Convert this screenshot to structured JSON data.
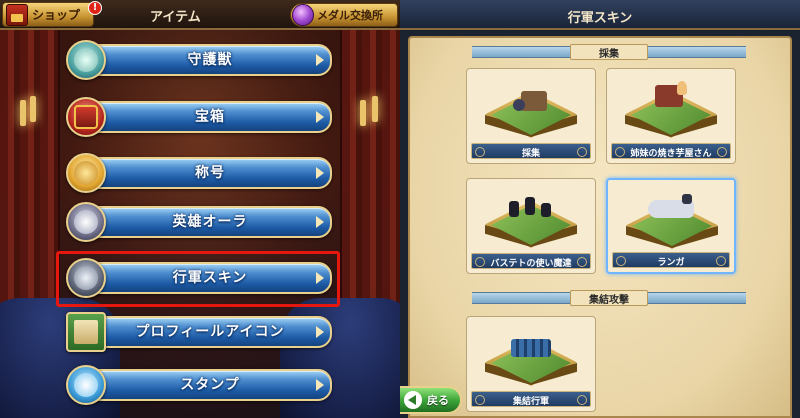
{
  "left_panel": {
    "shop_label": "ショップ",
    "shop_badge": "!",
    "tab_title": "アイテム",
    "medal_exchange_label": "メダル交換所",
    "menu": [
      {
        "label": "守護獣",
        "icon": "dragon-icon",
        "selected": false
      },
      {
        "label": "宝箱",
        "icon": "treasure-chest-icon",
        "selected": false
      },
      {
        "label": "称号",
        "icon": "emblem-icon",
        "selected": false
      },
      {
        "label": "英雄オーラ",
        "icon": "hero-aura-icon",
        "selected": false
      },
      {
        "label": "行軍スキン",
        "icon": "armored-knight-icon",
        "selected": true
      },
      {
        "label": "プロフィールアイコン",
        "icon": "profile-book-icon",
        "selected": false
      },
      {
        "label": "スタンプ",
        "icon": "stamp-character-icon",
        "selected": false
      }
    ]
  },
  "right_panel": {
    "title": "行軍スキン",
    "sections": [
      {
        "header": "採集",
        "cards": [
          {
            "name": "採集",
            "selected": false
          },
          {
            "name": "姉妹の焼き芋屋さん",
            "selected": false
          },
          {
            "name": "バステトの使い魔達",
            "selected": false
          },
          {
            "name": "ランガ",
            "selected": true
          }
        ]
      },
      {
        "header": "集結攻撃",
        "cards": [
          {
            "name": "集結行軍",
            "selected": false
          }
        ]
      }
    ],
    "back_label": "戻る"
  },
  "colors": {
    "menu_button": "#1d5ba6",
    "selection_frame": "#e6170f",
    "card_selected": "#6fb6ff",
    "back_button": "#3fa63a"
  }
}
